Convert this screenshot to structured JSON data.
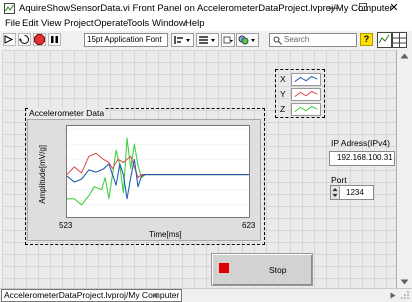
{
  "window": {
    "title": "AquireShowSensorData.vi Front Panel on AccelerometerDataProject.lvproj/My Computer",
    "controls": {
      "minimize": "—",
      "maximize": "☐",
      "close": "✕"
    }
  },
  "menu": {
    "items": [
      "File",
      "Edit",
      "View",
      "Project",
      "Operate",
      "Tools",
      "Window",
      "Help"
    ]
  },
  "toolbar": {
    "font_selector": "15pt Application Font",
    "search_placeholder": "Search",
    "help_label": "?"
  },
  "legend": {
    "entries": [
      {
        "label": "X",
        "color": "#1f5fb0"
      },
      {
        "label": "Y",
        "color": "#e05050"
      },
      {
        "label": "Z",
        "color": "#40d040"
      }
    ]
  },
  "graph": {
    "label": "Accelerometer Data",
    "ylabel": "Amplitude[mV/g]",
    "xlabel": "Time[ms]",
    "x_min_label": "523",
    "x_max_label": "623"
  },
  "chart_data": {
    "type": "line",
    "xlabel": "Time[ms]",
    "ylabel": "Amplitude[mV/g]",
    "xlim": [
      523,
      623
    ],
    "ylim": [
      -14,
      16
    ],
    "series": [
      {
        "name": "X",
        "color": "#1f5fb0",
        "points": [
          [
            523,
            -0.5
          ],
          [
            527,
            -2.5
          ],
          [
            531,
            -1.5
          ],
          [
            535,
            1.5
          ],
          [
            539,
            0.8
          ],
          [
            543,
            1.8
          ],
          [
            546,
            3.5
          ],
          [
            548,
            0
          ],
          [
            550,
            -3.5
          ],
          [
            552,
            3.5
          ],
          [
            554,
            0
          ],
          [
            556,
            -8
          ],
          [
            558,
            -1
          ],
          [
            560,
            5
          ],
          [
            562,
            -4
          ],
          [
            564,
            -0.5
          ],
          [
            566,
            0
          ],
          [
            623,
            0
          ]
        ]
      },
      {
        "name": "Y",
        "color": "#e05050",
        "points": [
          [
            523,
            0
          ],
          [
            527,
            2.5
          ],
          [
            531,
            0.5
          ],
          [
            535,
            6
          ],
          [
            539,
            7
          ],
          [
            543,
            5
          ],
          [
            546,
            4
          ],
          [
            548,
            2
          ],
          [
            551,
            5
          ],
          [
            554,
            4
          ],
          [
            556,
            5
          ],
          [
            558,
            6
          ],
          [
            560,
            2.5
          ],
          [
            562,
            -1
          ],
          [
            564,
            0
          ],
          [
            623,
            0
          ]
        ]
      },
      {
        "name": "Z",
        "color": "#40d040",
        "points": [
          [
            523,
            -8
          ],
          [
            527,
            -8
          ],
          [
            531,
            -10
          ],
          [
            535,
            -7
          ],
          [
            538,
            -4
          ],
          [
            542,
            -5
          ],
          [
            544,
            -1
          ],
          [
            546,
            -8
          ],
          [
            548,
            0
          ],
          [
            550,
            8
          ],
          [
            552,
            3
          ],
          [
            554,
            -6
          ],
          [
            556,
            12
          ],
          [
            558,
            2
          ],
          [
            560,
            10
          ],
          [
            562,
            3
          ],
          [
            564,
            -1
          ],
          [
            566,
            0
          ],
          [
            623,
            0
          ]
        ]
      }
    ]
  },
  "ip": {
    "label": "IP Adress(IPv4)",
    "value": "192.168.100.31"
  },
  "port": {
    "label": "Port",
    "value": "1234"
  },
  "stop": {
    "label": "Stop"
  },
  "status": {
    "path": "AccelerometerDataProject.lvproj/My Computer"
  }
}
